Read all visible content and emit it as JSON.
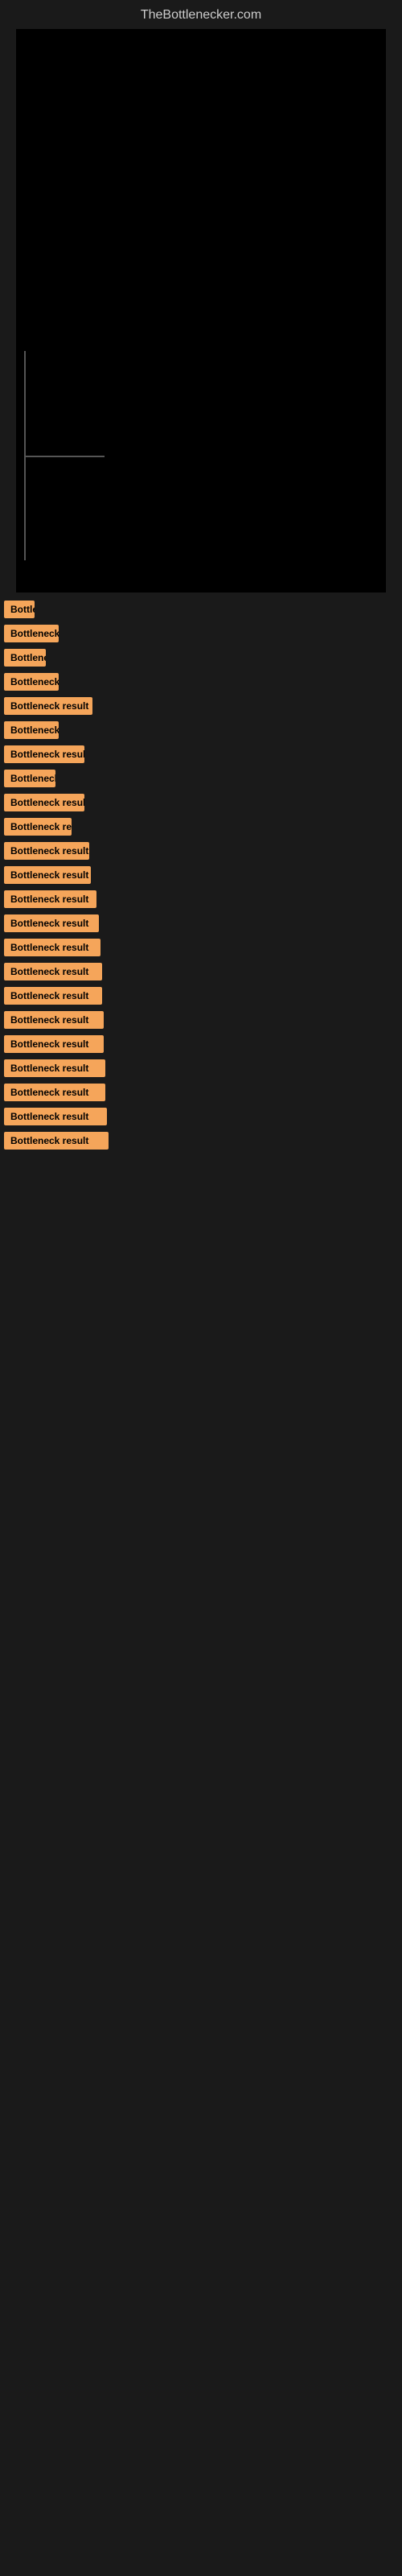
{
  "site": {
    "title": "TheBottlenecker.com"
  },
  "results": [
    {
      "id": 1,
      "label": "Bottleneck result",
      "width_class": "w1"
    },
    {
      "id": 2,
      "label": "Bottleneck result",
      "width_class": "w2"
    },
    {
      "id": 3,
      "label": "Bottleneck result",
      "width_class": "w3"
    },
    {
      "id": 4,
      "label": "Bottleneck result",
      "width_class": "w4"
    },
    {
      "id": 5,
      "label": "Bottleneck result",
      "width_class": "w5"
    },
    {
      "id": 6,
      "label": "Bottleneck result",
      "width_class": "w6"
    },
    {
      "id": 7,
      "label": "Bottleneck result",
      "width_class": "w7"
    },
    {
      "id": 8,
      "label": "Bottleneck result",
      "width_class": "w8"
    },
    {
      "id": 9,
      "label": "Bottleneck result",
      "width_class": "w9"
    },
    {
      "id": 10,
      "label": "Bottleneck result",
      "width_class": "w10"
    },
    {
      "id": 11,
      "label": "Bottleneck result",
      "width_class": "w11"
    },
    {
      "id": 12,
      "label": "Bottleneck result",
      "width_class": "w12"
    },
    {
      "id": 13,
      "label": "Bottleneck result",
      "width_class": "w13"
    },
    {
      "id": 14,
      "label": "Bottleneck result",
      "width_class": "w14"
    },
    {
      "id": 15,
      "label": "Bottleneck result",
      "width_class": "w15"
    },
    {
      "id": 16,
      "label": "Bottleneck result",
      "width_class": "w16"
    },
    {
      "id": 17,
      "label": "Bottleneck result",
      "width_class": "w17"
    },
    {
      "id": 18,
      "label": "Bottleneck result",
      "width_class": "w18"
    },
    {
      "id": 19,
      "label": "Bottleneck result",
      "width_class": "w19"
    },
    {
      "id": 20,
      "label": "Bottleneck result",
      "width_class": "w20"
    },
    {
      "id": 21,
      "label": "Bottleneck result",
      "width_class": "w21"
    },
    {
      "id": 22,
      "label": "Bottleneck result",
      "width_class": "w22"
    },
    {
      "id": 23,
      "label": "Bottleneck result",
      "width_class": "w23"
    }
  ],
  "colors": {
    "background": "#1a1a1a",
    "chart_bg": "#000000",
    "badge_bg": "#f5a55a",
    "badge_text": "#000000",
    "site_title": "#cccccc"
  }
}
